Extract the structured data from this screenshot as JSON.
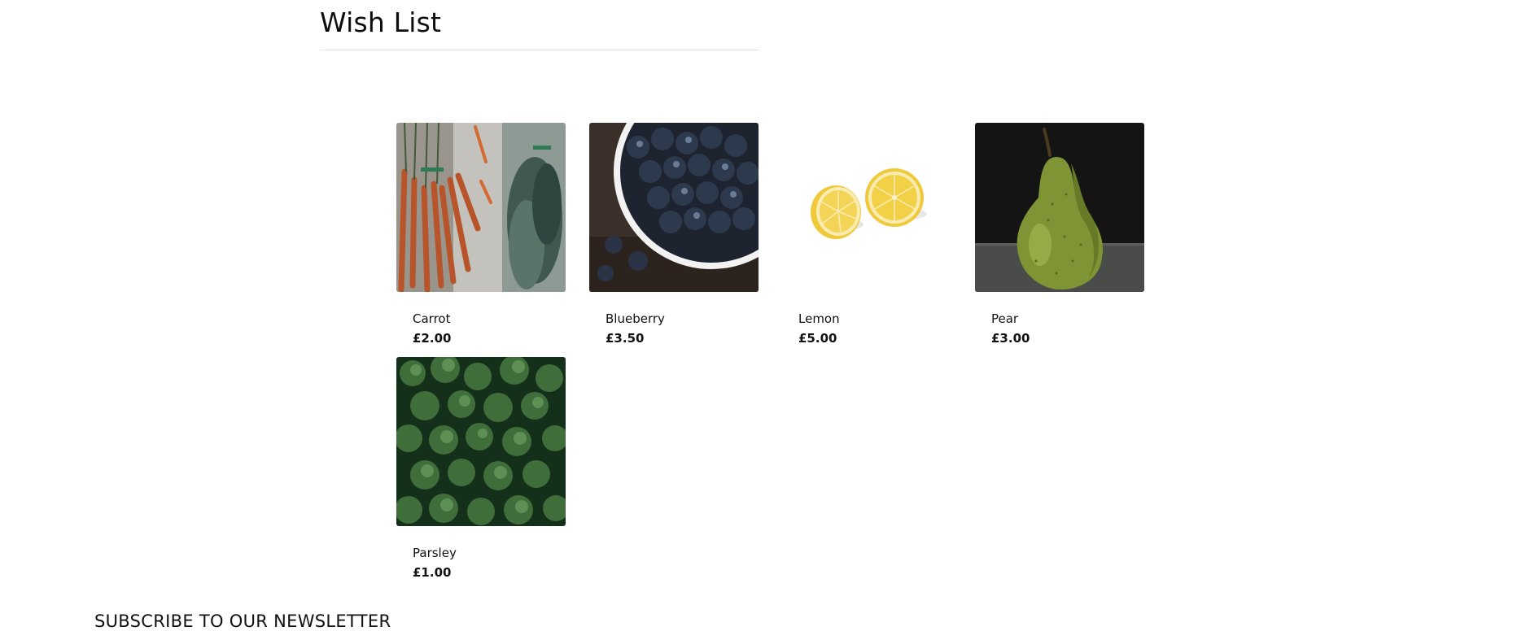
{
  "page": {
    "title": "Wish List"
  },
  "products": [
    {
      "name": "Carrot",
      "price": "£2.00",
      "image": "carrot-bunch-photo"
    },
    {
      "name": "Blueberry",
      "price": "£3.50",
      "image": "blueberry-bowl-photo"
    },
    {
      "name": "Lemon",
      "price": "£5.00",
      "image": "lemon-halves-photo"
    },
    {
      "name": "Pear",
      "price": "£3.00",
      "image": "green-pear-photo"
    },
    {
      "name": "Parsley",
      "price": "£1.00",
      "image": "parsley-leaves-photo"
    }
  ],
  "newsletter": {
    "heading": "SUBSCRIBE TO OUR NEWSLETTER"
  }
}
